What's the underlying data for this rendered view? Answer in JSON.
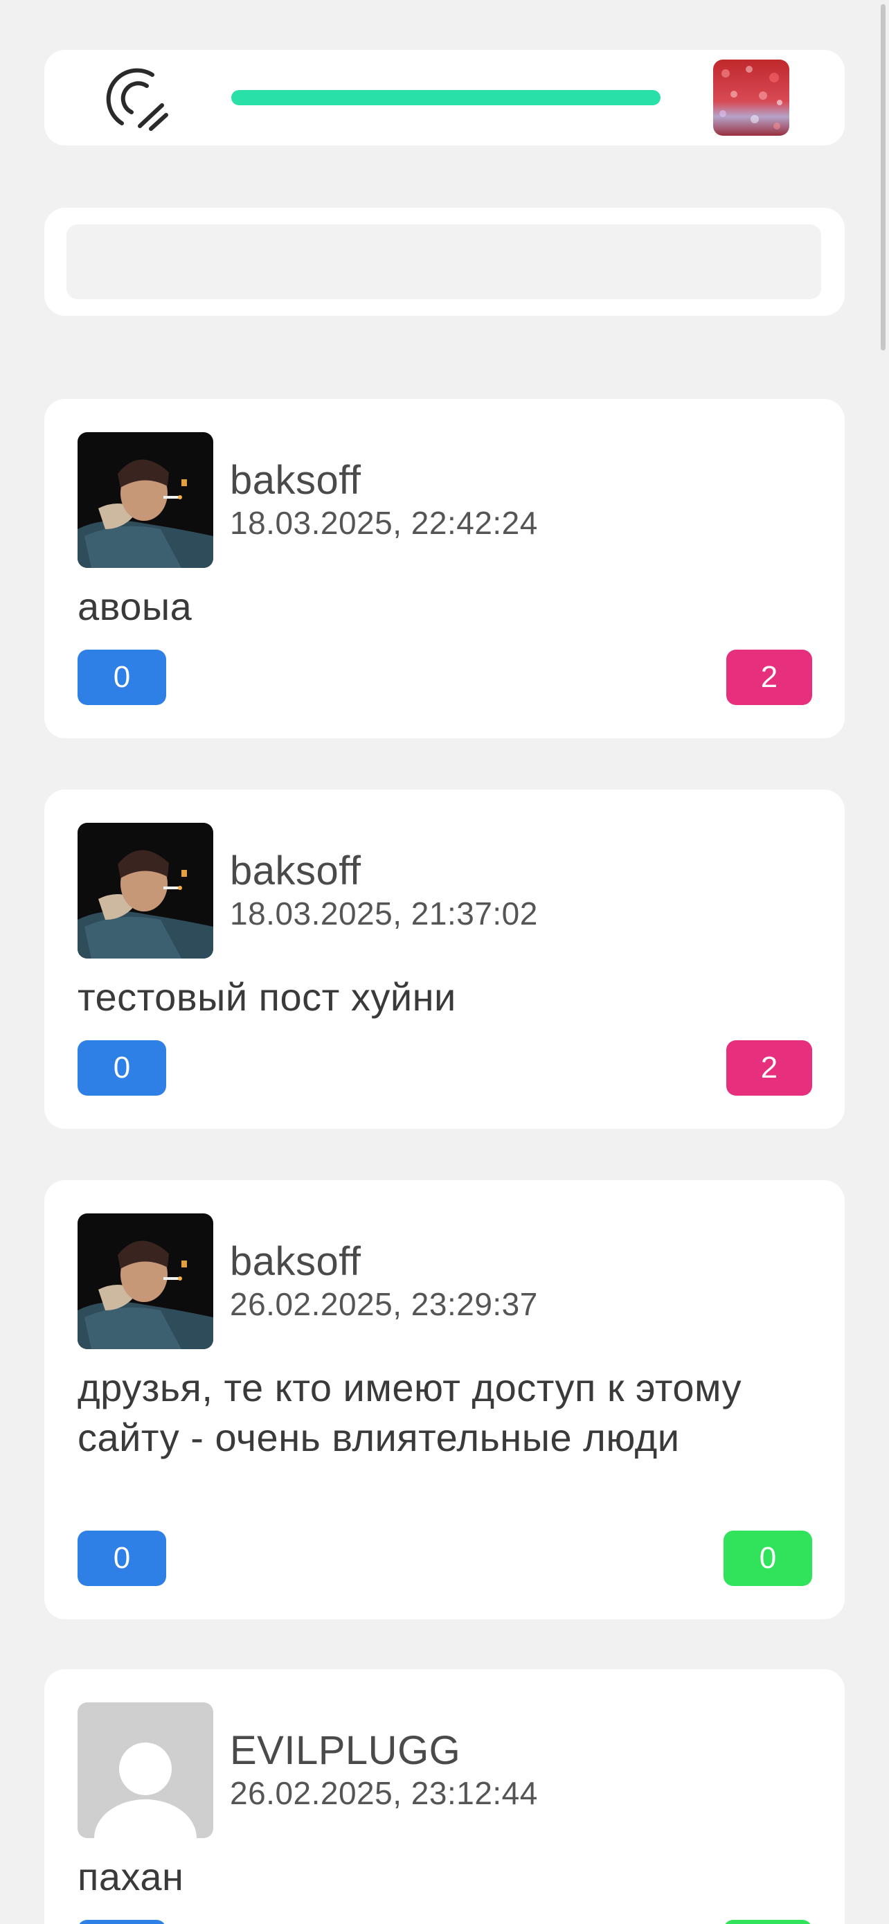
{
  "header": {
    "logo_icon": "c-slash-logo",
    "progress": 1.0,
    "accent_color": "#28e0a8"
  },
  "search": {
    "placeholder": ""
  },
  "posts": [
    {
      "author": "baksoff",
      "date": "18.03.2025, 22:42:24",
      "text": "авоыа",
      "left_count": "0",
      "right_count": "2",
      "right_color": "pink",
      "avatar": "photo"
    },
    {
      "author": "baksoff",
      "date": "18.03.2025, 21:37:02",
      "text": "тестовый пост хуйни",
      "left_count": "0",
      "right_count": "2",
      "right_color": "pink",
      "avatar": "photo"
    },
    {
      "author": "baksoff",
      "date": "26.02.2025, 23:29:37",
      "text": "друзья, те кто имеют доступ к этому сайту - очень влиятельные люди",
      "left_count": "0",
      "right_count": "0",
      "right_color": "green",
      "avatar": "photo"
    },
    {
      "author": "EVILPLUGG",
      "date": "26.02.2025, 23:12:44",
      "text": "пахан",
      "left_count": "",
      "right_count": "",
      "right_color": "green",
      "avatar": "placeholder"
    }
  ],
  "colors": {
    "blue": "#2f80e6",
    "pink": "#e6307e",
    "green": "#30e35a",
    "background": "#f1f1f1"
  }
}
